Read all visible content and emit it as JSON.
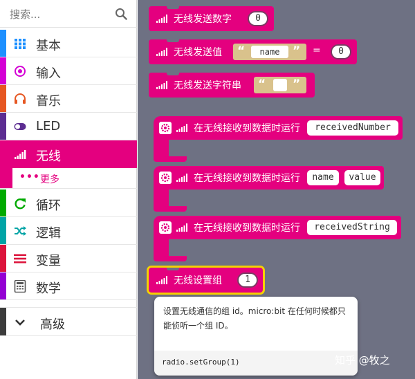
{
  "search": {
    "placeholder": "搜索..."
  },
  "categories": [
    {
      "label": "基本",
      "color": "#1e90ff",
      "icon": "grid-icon"
    },
    {
      "label": "输入",
      "color": "#d400d4",
      "icon": "target-icon"
    },
    {
      "label": "音乐",
      "color": "#e65722",
      "icon": "headphones-icon"
    },
    {
      "label": "LED",
      "color": "#5c2d91",
      "icon": "toggle-icon"
    },
    {
      "label": "无线",
      "color": "#e4007f",
      "icon": "signal-icon",
      "selected": true
    },
    {
      "label": "循环",
      "color": "#00aa00",
      "icon": "loop-icon"
    },
    {
      "label": "逻辑",
      "color": "#00a4a6",
      "icon": "shuffle-icon"
    },
    {
      "label": "变量",
      "color": "#dc143c",
      "icon": "list-icon"
    },
    {
      "label": "数学",
      "color": "#9400d3",
      "icon": "calculator-icon"
    },
    {
      "label": "高级",
      "color": "#3c3c3c",
      "icon": "chevron-down-icon"
    }
  ],
  "more": {
    "label": "更多"
  },
  "blocks": {
    "send_number": {
      "label": "无线发送数字",
      "value": "0"
    },
    "send_value": {
      "label": "无线发送值",
      "name": "name",
      "eq": "=",
      "value": "0"
    },
    "send_string": {
      "label": "无线发送字符串"
    },
    "recv_number": {
      "label": "在无线接收到数据时运行",
      "var": "receivedNumber"
    },
    "recv_value": {
      "label": "在无线接收到数据时运行",
      "var1": "name",
      "var2": "value"
    },
    "recv_string": {
      "label": "在无线接收到数据时运行",
      "var": "receivedString"
    },
    "set_group": {
      "label": "无线设置组",
      "value": "1"
    }
  },
  "tooltip": {
    "description": "设置无线通信的组 id。micro:bit 在任何时候都只能侦听一个组 ID。",
    "code": "radio.setGroup(1)"
  },
  "watermark": "知乎 @牧之",
  "colors": {
    "radio": "#e4007f",
    "workspace": "#6e7183"
  }
}
